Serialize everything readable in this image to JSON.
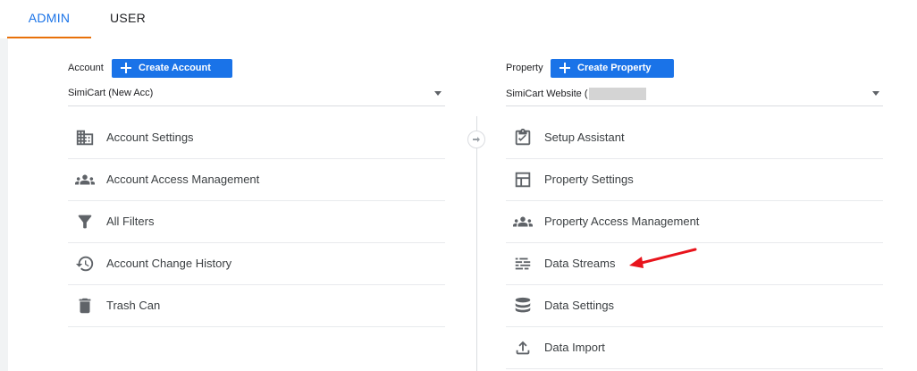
{
  "tabs": {
    "admin": "ADMIN",
    "user": "USER"
  },
  "account": {
    "label": "Account",
    "create_button": "Create Account",
    "selected": "SimiCart (New Acc)",
    "items": [
      {
        "label": "Account Settings",
        "icon": "building-icon"
      },
      {
        "label": "Account Access Management",
        "icon": "people-icon"
      },
      {
        "label": "All Filters",
        "icon": "filter-icon"
      },
      {
        "label": "Account Change History",
        "icon": "history-icon"
      },
      {
        "label": "Trash Can",
        "icon": "trash-icon"
      }
    ]
  },
  "property": {
    "label": "Property",
    "create_button": "Create Property",
    "selected": "SimiCart Website (",
    "items": [
      {
        "label": "Setup Assistant",
        "icon": "clipboard-check-icon"
      },
      {
        "label": "Property Settings",
        "icon": "layout-icon"
      },
      {
        "label": "Property Access Management",
        "icon": "people-icon"
      },
      {
        "label": "Data Streams",
        "icon": "data-streams-icon"
      },
      {
        "label": "Data Settings",
        "icon": "database-icon"
      },
      {
        "label": "Data Import",
        "icon": "upload-icon"
      }
    ]
  },
  "colors": {
    "accent_blue": "#1a73e8",
    "tab_underline": "#e8710a",
    "icon_gray": "#5f6368",
    "annotation_arrow": "#e8141c"
  }
}
